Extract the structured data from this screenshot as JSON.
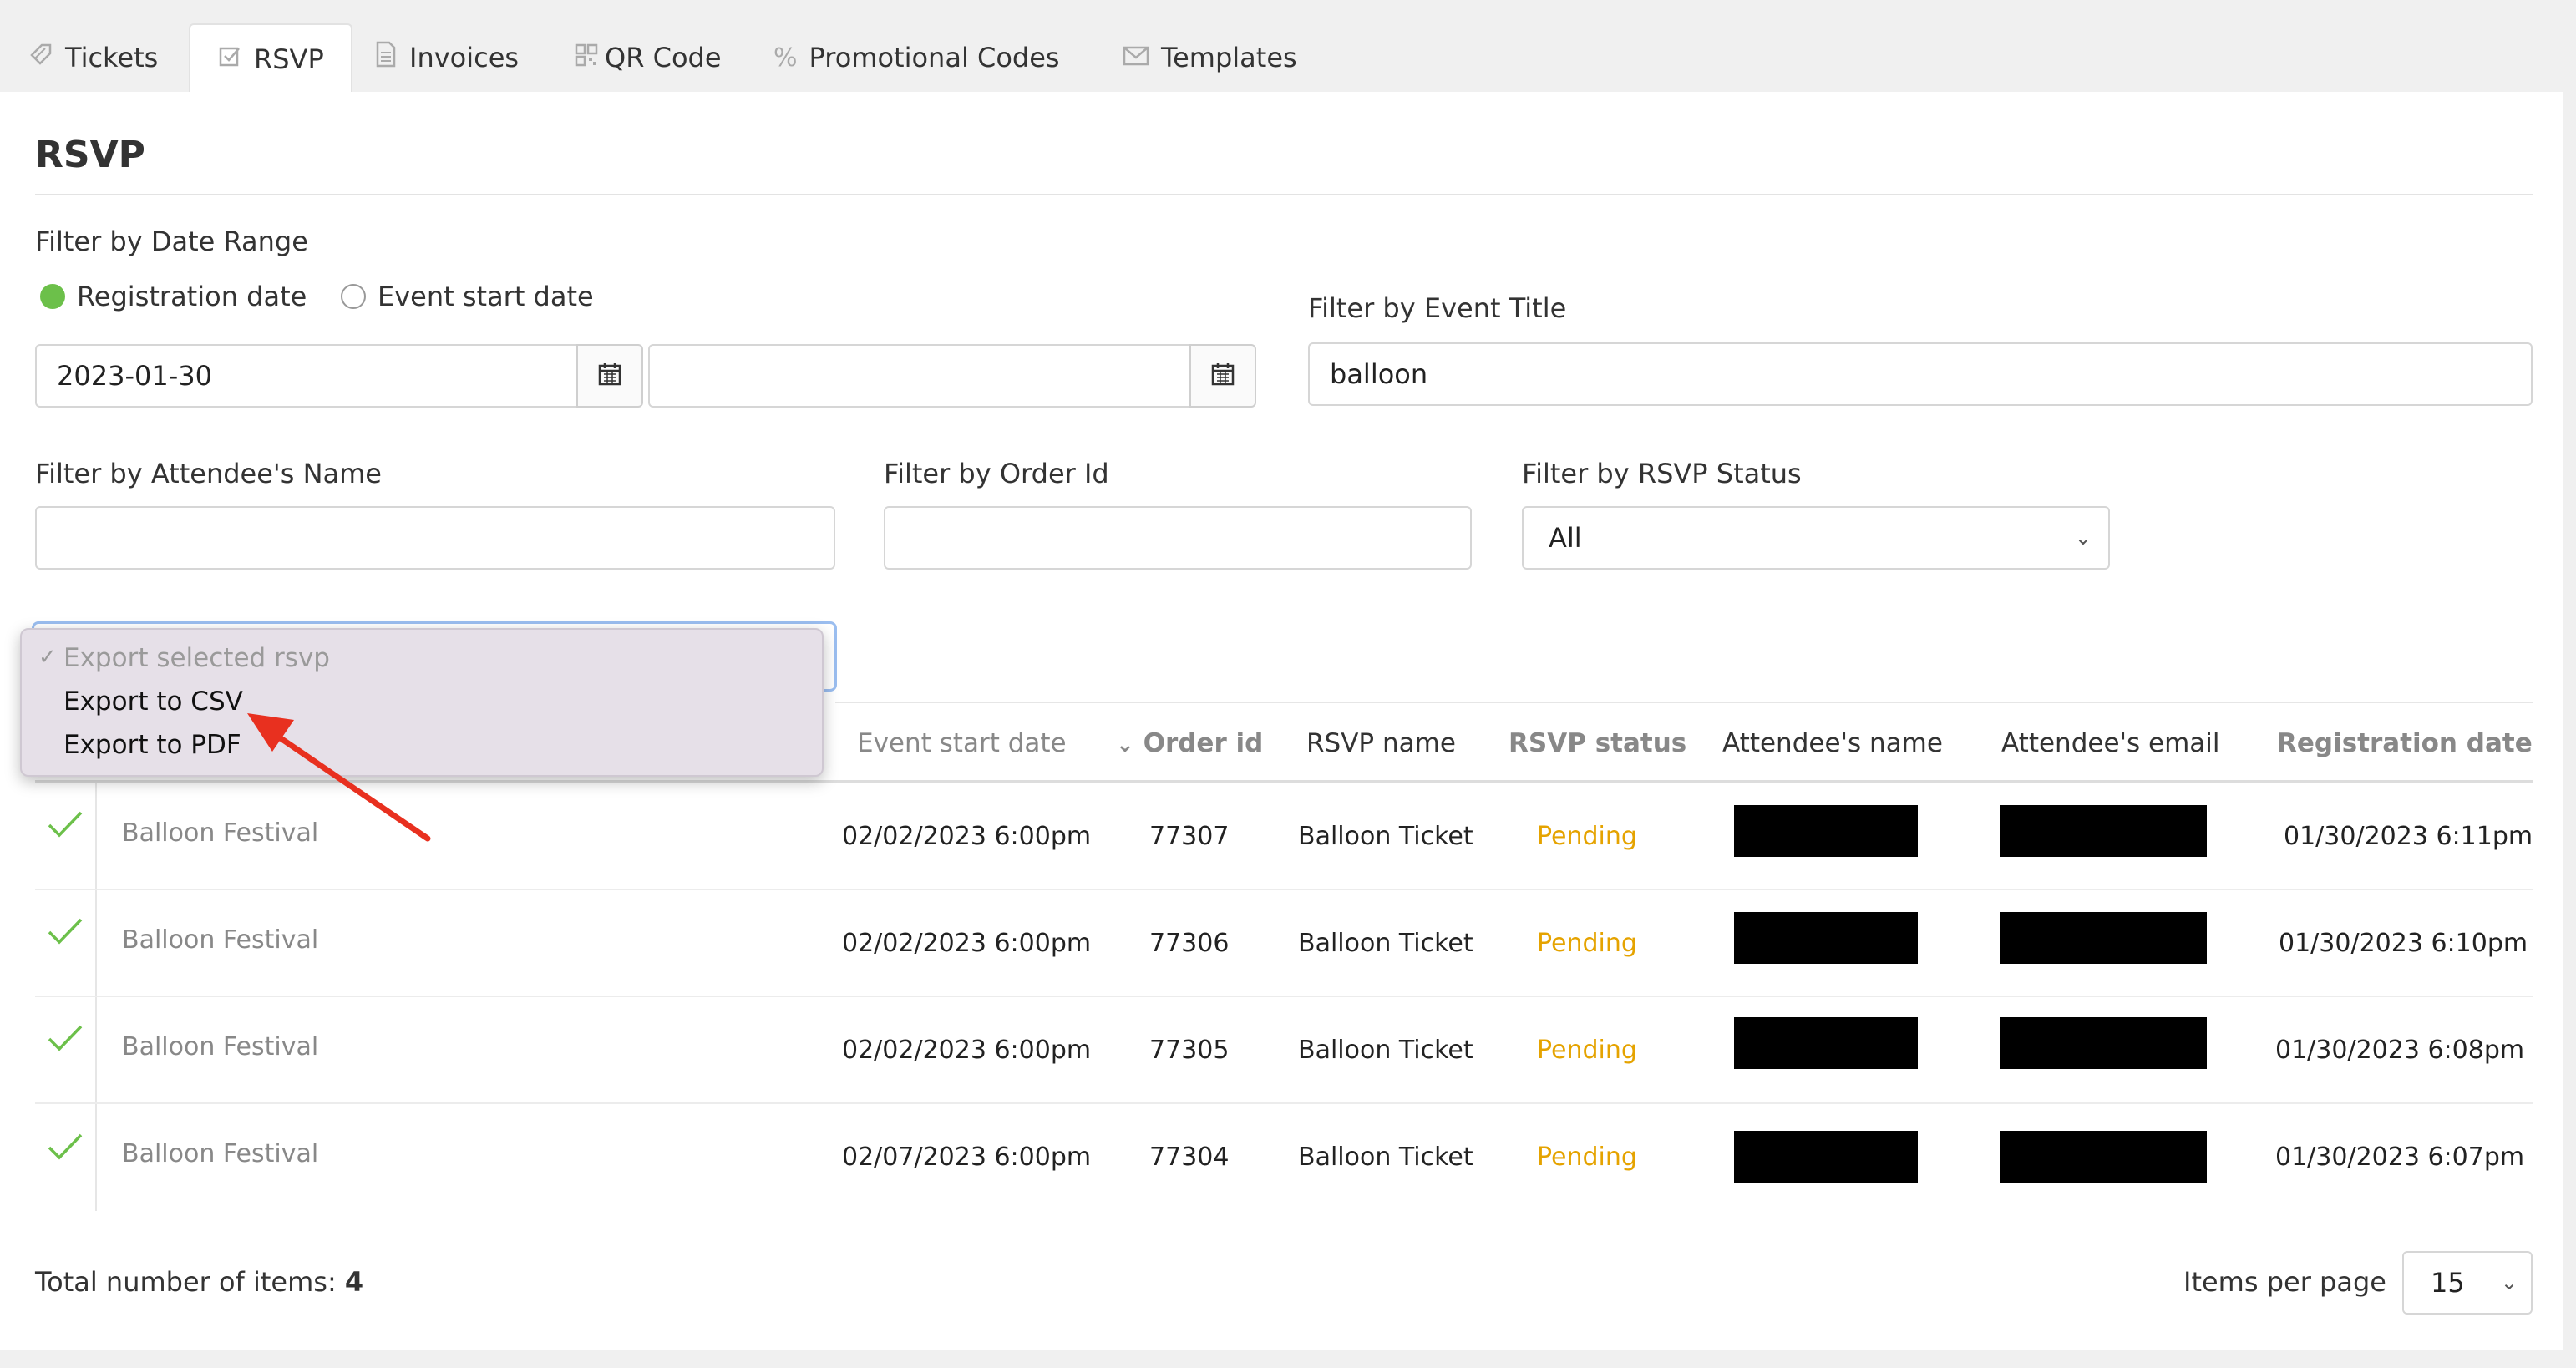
{
  "tabs": [
    {
      "label": "Tickets",
      "icon": "ticket-icon"
    },
    {
      "label": "RSVP",
      "icon": "checkbox-icon"
    },
    {
      "label": "Invoices",
      "icon": "document-icon"
    },
    {
      "label": "QR Code",
      "icon": "qr-icon"
    },
    {
      "label": "Promotional Codes",
      "icon": "percent-icon"
    },
    {
      "label": "Templates",
      "icon": "envelope-icon"
    }
  ],
  "page_title": "RSVP",
  "filters": {
    "date_range_label": "Filter by Date Range",
    "radio_registration": "Registration date",
    "radio_event_start": "Event start date",
    "date_from": "2023-01-30",
    "date_to": "",
    "event_title_label": "Filter by Event Title",
    "event_title_value": "balloon",
    "attendee_name_label": "Filter by Attendee's Name",
    "attendee_name_value": "",
    "order_id_label": "Filter by Order Id",
    "order_id_value": "",
    "rsvp_status_label": "Filter by RSVP Status",
    "rsvp_status_value": "All"
  },
  "export_dropdown": {
    "options": [
      "Export selected rsvp",
      "Export to CSV",
      "Export to PDF"
    ]
  },
  "table": {
    "headers": [
      "Event start date",
      "Order id",
      "RSVP name",
      "RSVP status",
      "Attendee's name",
      "Attendee's email",
      "Registration date"
    ],
    "rows": [
      {
        "event": "Balloon Festival",
        "start": "02/02/2023 6:00pm",
        "order": "77307",
        "rsvp_name": "Balloon Ticket",
        "status": "Pending",
        "registered": "01/30/2023 6:11pm"
      },
      {
        "event": "Balloon Festival",
        "start": "02/02/2023 6:00pm",
        "order": "77306",
        "rsvp_name": "Balloon Ticket",
        "status": "Pending",
        "registered": "01/30/2023 6:10pm"
      },
      {
        "event": "Balloon Festival",
        "start": "02/02/2023 6:00pm",
        "order": "77305",
        "rsvp_name": "Balloon Ticket",
        "status": "Pending",
        "registered": "01/30/2023 6:08pm"
      },
      {
        "event": "Balloon Festival",
        "start": "02/07/2023 6:00pm",
        "order": "77304",
        "rsvp_name": "Balloon Ticket",
        "status": "Pending",
        "registered": "01/30/2023 6:07pm"
      }
    ]
  },
  "footer": {
    "total_label": "Total number of items:",
    "total_value": "4",
    "per_page_label": "Items per page",
    "per_page_value": "15"
  },
  "colors": {
    "accent_green": "#6cc04a",
    "pending": "#e5a300",
    "annotation_arrow": "#e8301f"
  }
}
